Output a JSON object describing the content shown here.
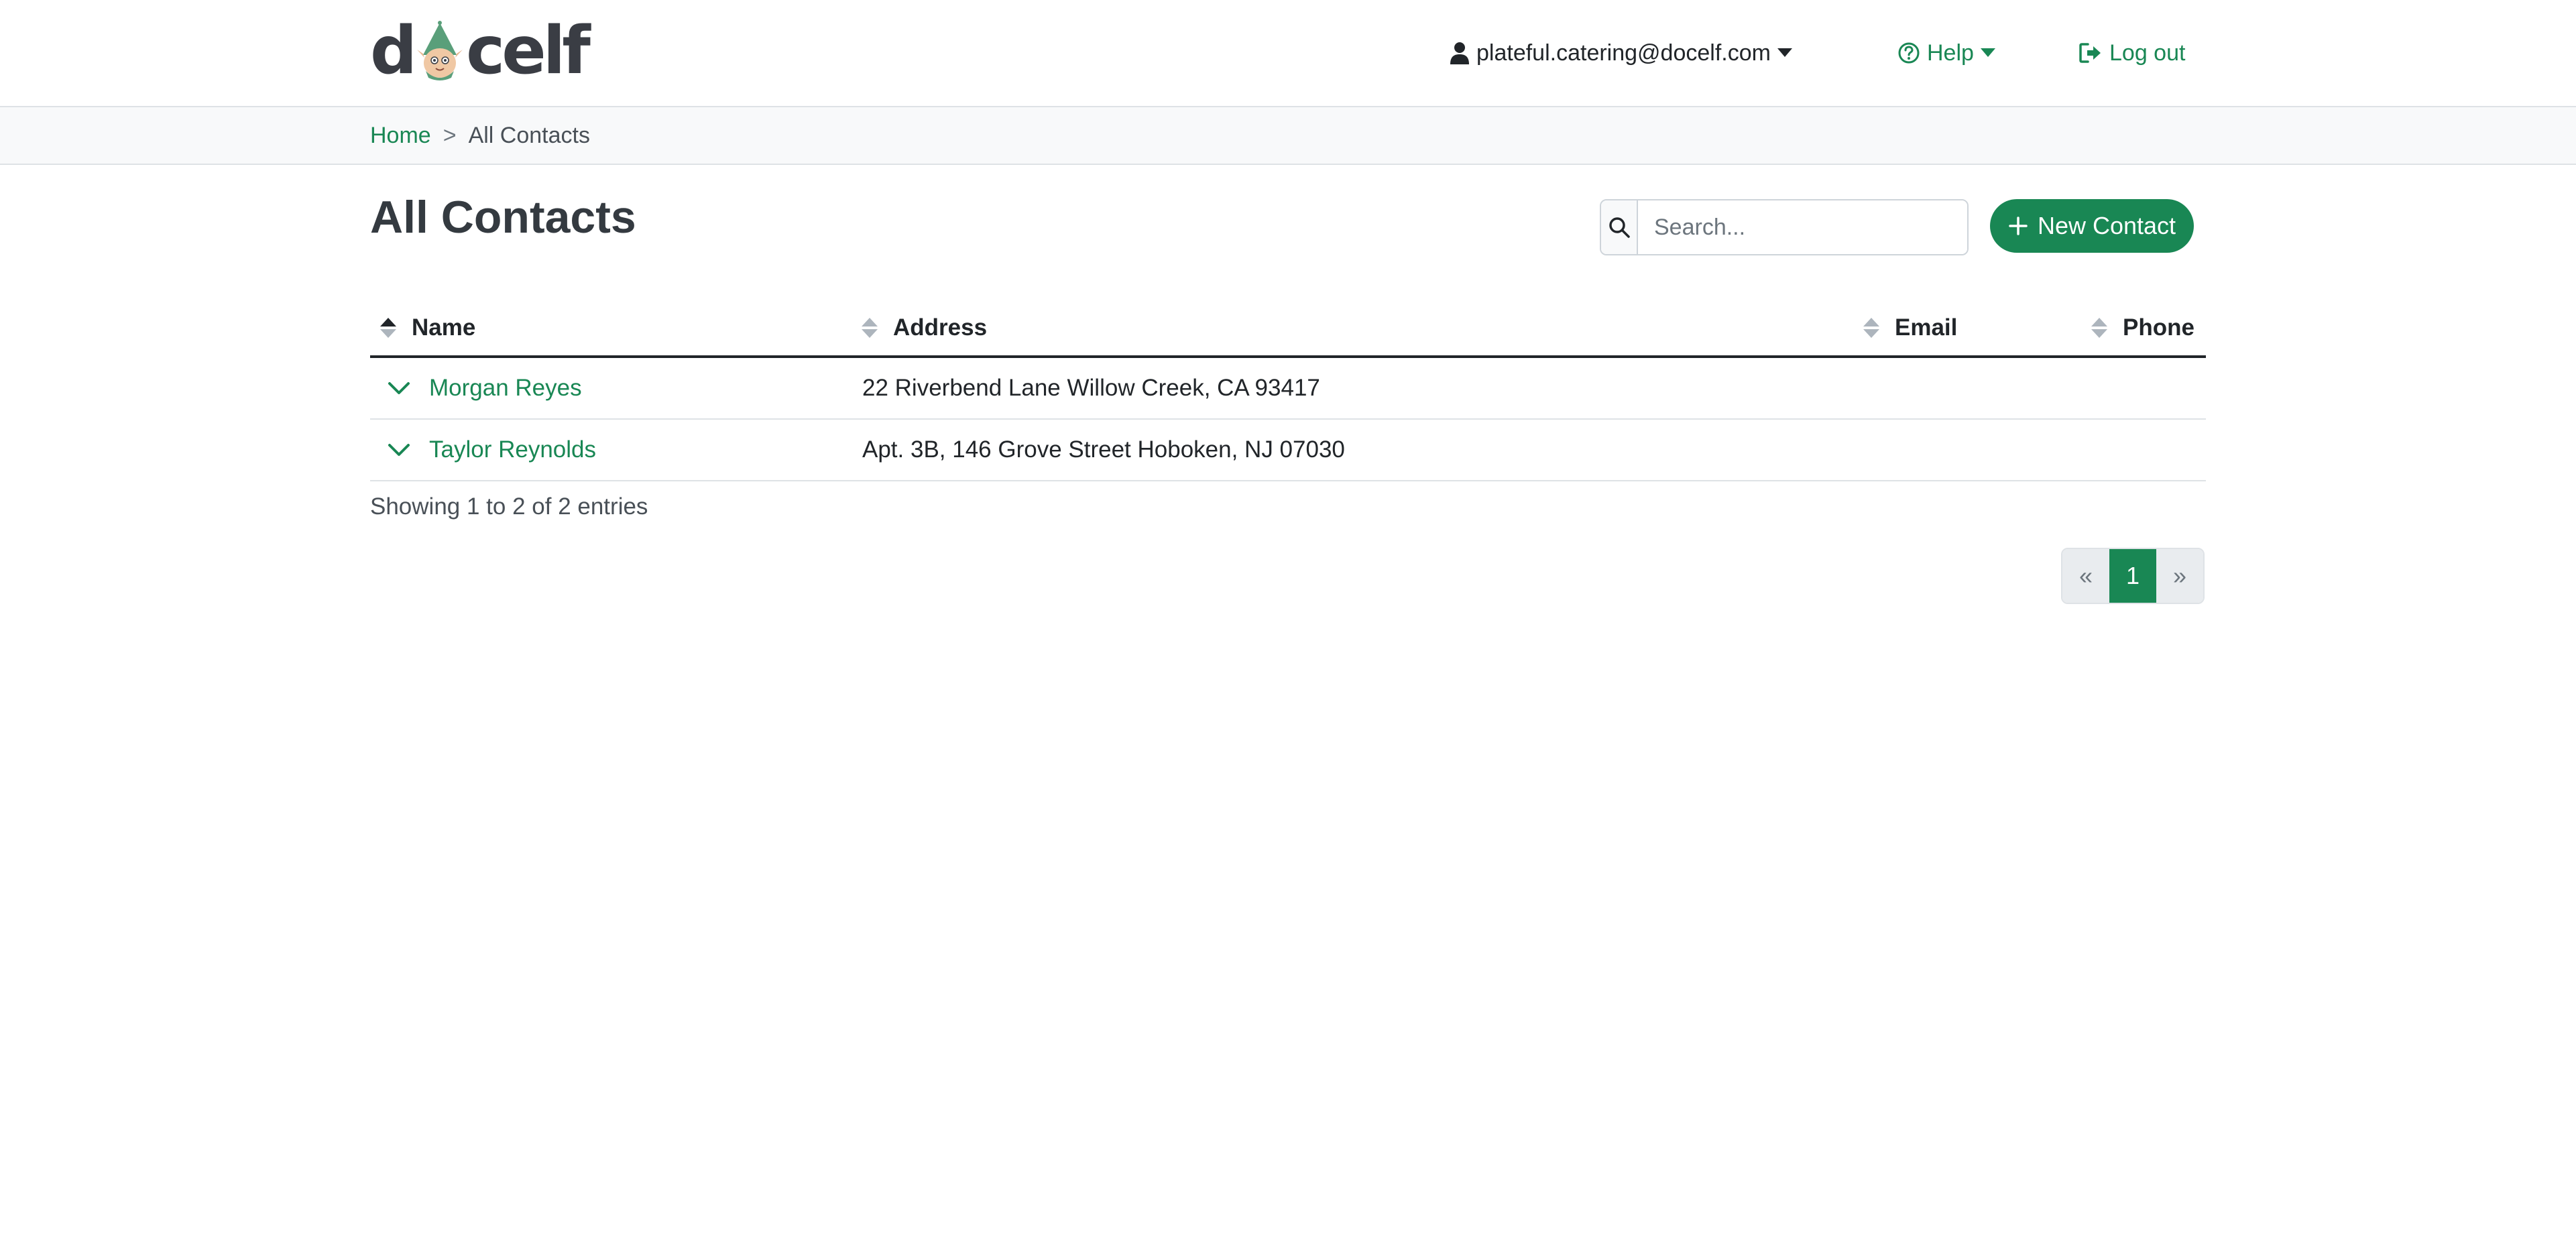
{
  "header": {
    "logo_text_left": "d",
    "logo_text_right": "celf",
    "user_email": "plateful.catering@docelf.com",
    "help_label": "Help",
    "logout_label": "Log out"
  },
  "breadcrumb": {
    "home": "Home",
    "separator": ">",
    "current": "All Contacts"
  },
  "page": {
    "title": "All Contacts",
    "search_placeholder": "Search...",
    "new_contact_label": "New Contact"
  },
  "table": {
    "columns": [
      "Name",
      "Address",
      "Email",
      "Phone"
    ],
    "rows": [
      {
        "name": "Morgan Reyes",
        "address": "22 Riverbend Lane Willow Creek, CA 93417",
        "email": "",
        "phone": ""
      },
      {
        "name": "Taylor Reynolds",
        "address": "Apt. 3B, 146 Grove Street Hoboken, NJ 07030",
        "email": "",
        "phone": ""
      }
    ],
    "info": "Showing 1 to 2 of 2 entries"
  },
  "pagination": {
    "prev": "«",
    "pages": [
      "1"
    ],
    "next": "»",
    "current": "1"
  },
  "colors": {
    "accent": "#198754",
    "text": "#343a40",
    "border": "#dee2e6",
    "crumb_bg": "#f8f9fa"
  }
}
